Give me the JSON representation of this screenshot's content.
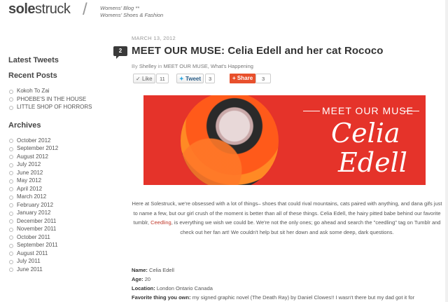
{
  "header": {
    "logo_bold": "sole",
    "logo_light": "struck",
    "slash": "/",
    "tagline_line1": "Womens' Blog **",
    "tagline_line2": "Womens' Shoes & Fashion"
  },
  "sidebar": {
    "latest_tweets_heading": "Latest Tweets",
    "recent_posts_heading": "Recent Posts",
    "recent_posts": [
      "Kokoh To Zai",
      "PHOEBE'S IN THE HOUSE",
      "LITTLE SHOP OF HORRORS"
    ],
    "archives_heading": "Archives",
    "archives": [
      "October 2012",
      "September 2012",
      "August 2012",
      "July 2012",
      "June 2012",
      "May 2012",
      "April 2012",
      "March 2012",
      "February 2012",
      "January 2012",
      "December 2011",
      "November 2011",
      "October 2011",
      "September 2011",
      "August 2011",
      "July 2011",
      "June 2011"
    ]
  },
  "post": {
    "date": "MARCH 13, 2012",
    "comment_count": "2",
    "title": "MEET OUR MUSE: Celia Edell and her cat Rococo",
    "byline_prefix": "By",
    "author": "Shelley",
    "byline_in": "in",
    "categories": "MEET OUR MUSE, What's Happening",
    "like_label": "Like",
    "like_count": "11",
    "tweet_label": "Tweet",
    "tweet_count": "3",
    "share_label": "Share",
    "share_count": "3",
    "banner_heading": "MEET OUR MUSE",
    "banner_name_first": "Celia",
    "banner_name_last": "Edell",
    "intro_part1": "Here at Solestruck, we're obsessed with a lot of things– shoes that could rival mountains, cats paired with anything, and dana gifs just to name a few, but our girl crush of the moment is better than all of these things. Celia Edell, the hairy pitted babe behind our favorite tumblr, ",
    "intro_link": "Ceedling",
    "intro_part2": ", is everything we wish we could be. We're not the only ones; go ahead and search the \"ceedling\" tag on Tumblr and check out her fan art! We couldn't help but sit her down and ask some deep, dark questions.",
    "facts": [
      {
        "label": "Name:",
        "value": "Celia Edell"
      },
      {
        "label": "Age:",
        "value": "20"
      },
      {
        "label": "Location:",
        "value": "London Ontario Canada"
      },
      {
        "label": "Favorite thing you own:",
        "value": "my signed graphic novel (The Death Ray) by Daniel Clowes!! I wasn't there but my dad got it for"
      }
    ]
  },
  "colors": {
    "banner_red": "#e5332a",
    "share_orange": "#e8502c",
    "link_red": "#c0392b"
  }
}
